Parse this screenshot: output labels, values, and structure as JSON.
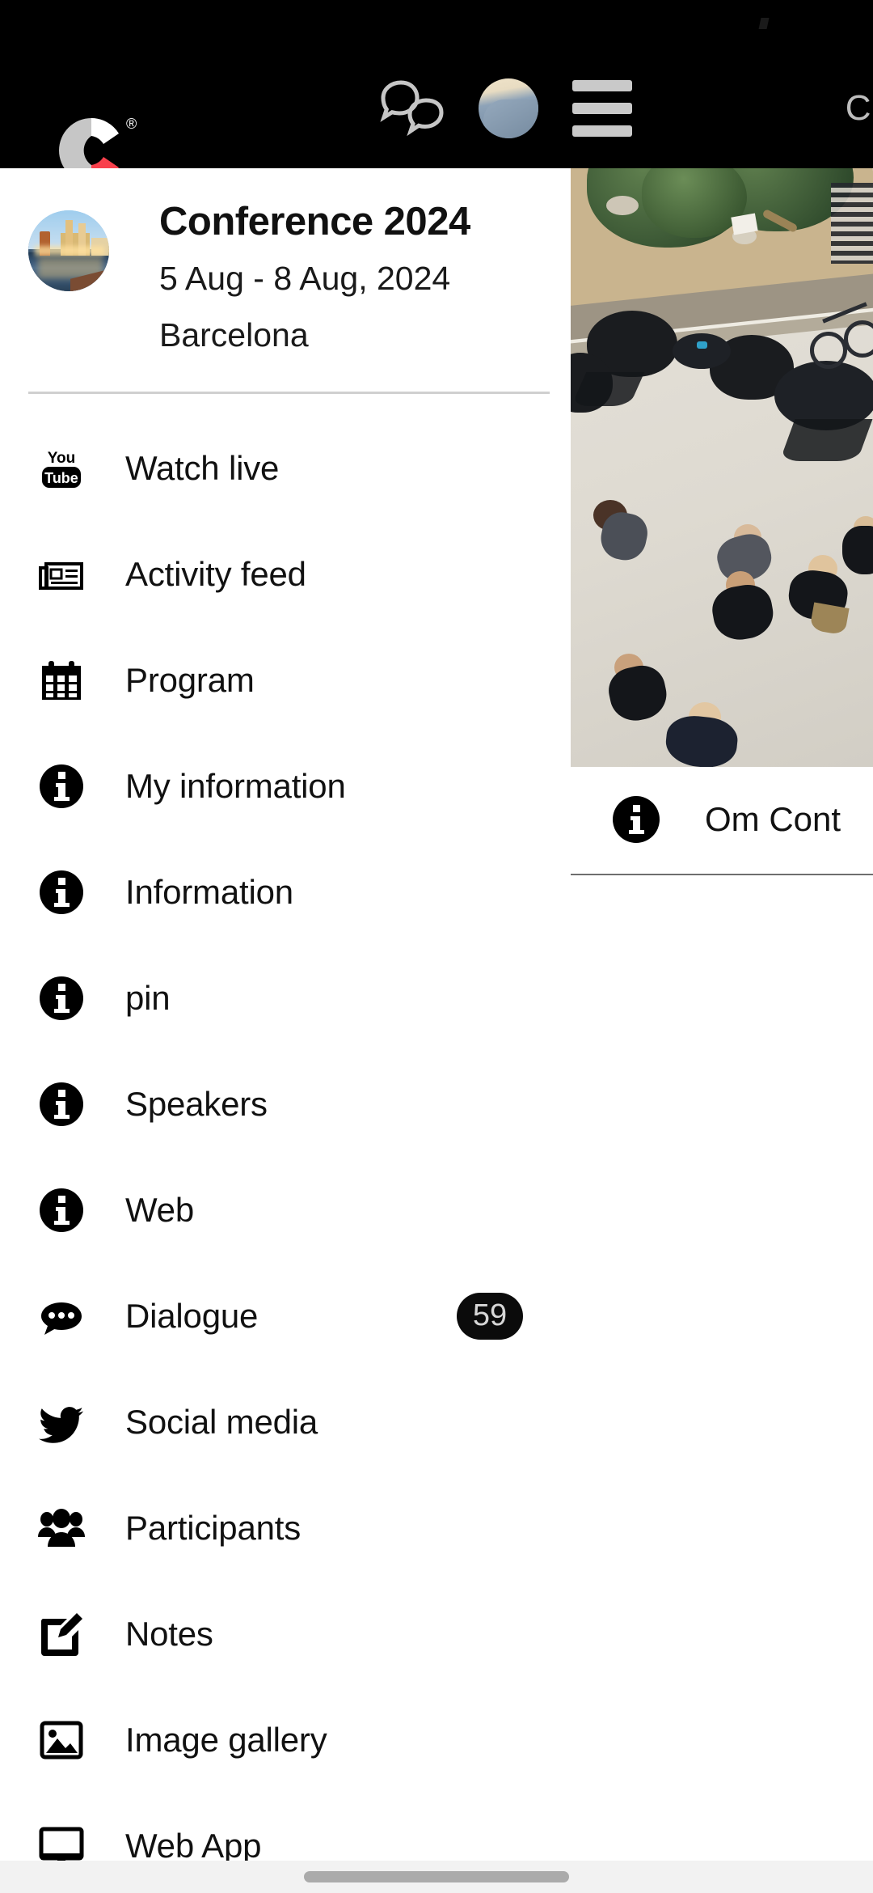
{
  "header": {
    "logo_name": "C",
    "logo_registered_mark": "®",
    "chat_icon": "chat-bubbles-icon",
    "avatar_icon": "user-avatar",
    "menu_icon": "hamburger-menu-icon",
    "right_truncated_text": "C",
    "background_color": "#000000",
    "icon_color": "#c9c9c9"
  },
  "sidebar": {
    "conference": {
      "title": "Conference 2024",
      "dates": "5 Aug - 8 Aug, 2024",
      "city": "Barcelona",
      "avatar_icon": "conference-city-photo"
    },
    "items": [
      {
        "label": "Watch live",
        "icon": "youtube-icon",
        "badge": null
      },
      {
        "label": "Activity feed",
        "icon": "newspaper-icon",
        "badge": null
      },
      {
        "label": "Program",
        "icon": "calendar-icon",
        "badge": null
      },
      {
        "label": "My information",
        "icon": "info-circle-icon",
        "badge": null
      },
      {
        "label": "Information",
        "icon": "info-circle-icon",
        "badge": null
      },
      {
        "label": "pin",
        "icon": "info-circle-icon",
        "badge": null
      },
      {
        "label": "Speakers",
        "icon": "info-circle-icon",
        "badge": null
      },
      {
        "label": "Web",
        "icon": "info-circle-icon",
        "badge": null
      },
      {
        "label": "Dialogue",
        "icon": "chat-dots-icon",
        "badge": "59"
      },
      {
        "label": "Social media",
        "icon": "twitter-bird-icon",
        "badge": null
      },
      {
        "label": "Participants",
        "icon": "users-group-icon",
        "badge": null
      },
      {
        "label": "Notes",
        "icon": "pencil-square-icon",
        "badge": null
      },
      {
        "label": "Image gallery",
        "icon": "image-icon",
        "badge": null
      },
      {
        "label": "Web App",
        "icon": "monitor-icon",
        "badge": null
      }
    ],
    "badge_background": "#0b0b0b",
    "badge_text_color": "#d6d6d6"
  },
  "content": {
    "hero_image": "conference-venue-aerial-photo",
    "row_label": "Om Cont",
    "row_icon": "info-circle-icon"
  },
  "navbar": {
    "home_indicator": "home-indicator-pill",
    "background_color": "#f2f2f2",
    "indicator_color": "#ababab"
  }
}
